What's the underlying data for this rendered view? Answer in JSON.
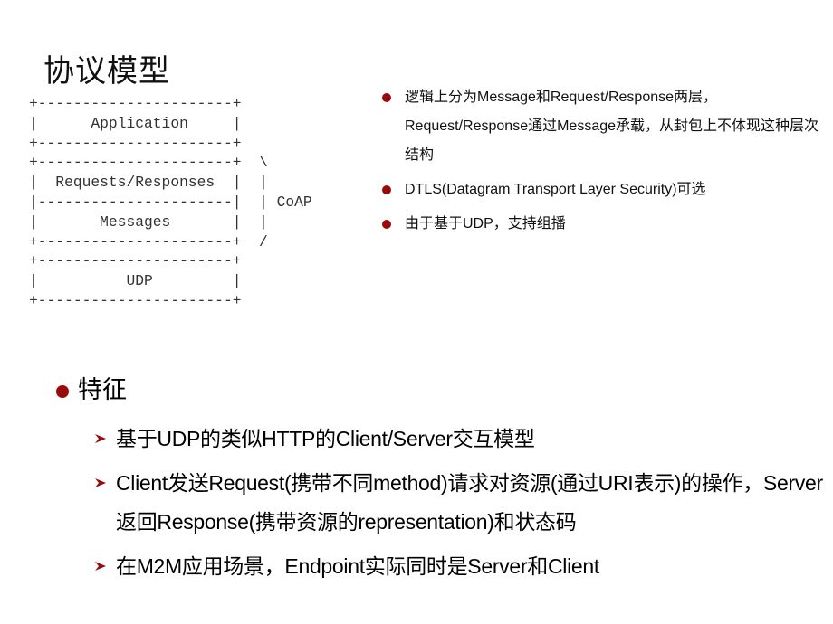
{
  "slide": {
    "title": "协议模型",
    "diagram": {
      "ascii": "+----------------------+\n|      Application     |\n+----------------------+\n+----------------------+  \\\n|  Requests/Responses  |  |\n|----------------------|  | CoAP\n|       Messages       |  |\n+----------------------+  /\n+----------------------+\n|          UDP         |\n+----------------------+",
      "layers": [
        "Application",
        "Requests/Responses",
        "Messages",
        "UDP"
      ],
      "bracket_label": "CoAP"
    },
    "right_bullets": [
      {
        "icon": "red-dot-bullet",
        "text": " 逻辑上分为Message和Request/Response两层，Request/Response通过Message承载，从封包上不体现这种层次结构"
      },
      {
        "icon": "red-dot-bullet",
        "text": "DTLS(Datagram Transport Layer Security)可选"
      },
      {
        "icon": "red-dot-bullet",
        "text": "由于基于UDP，支持组播"
      }
    ],
    "features": {
      "heading": "特征",
      "items": [
        {
          "icon": "arrow-bullet",
          "text": "基于UDP的类似HTTP的Client/Server交互模型"
        },
        {
          "icon": "arrow-bullet",
          "text": "Client发送Request(携带不同method)请求对资源(通过URI表示)的操作，Server返回Response(携带资源的representation)和状态码"
        },
        {
          "icon": "arrow-bullet",
          "text": "在M2M应用场景，Endpoint实际同时是Server和Client"
        }
      ]
    },
    "colors": {
      "bullet": "#9b0a0a",
      "text": "#111111",
      "diagram_text": "#333333",
      "background": "#ffffff"
    }
  }
}
